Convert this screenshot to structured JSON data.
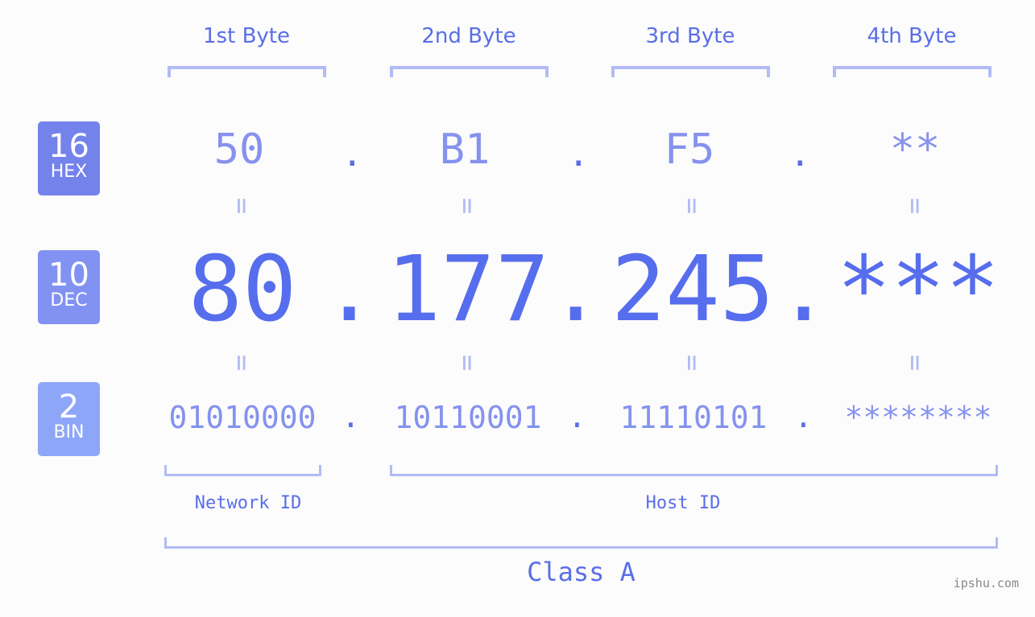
{
  "byte_headers": [
    "1st Byte",
    "2nd Byte",
    "3rd Byte",
    "4th Byte"
  ],
  "badges": {
    "hex": {
      "base": "16",
      "label": "HEX",
      "color": "#7482ec"
    },
    "dec": {
      "base": "10",
      "label": "DEC",
      "color": "#8292f2"
    },
    "bin": {
      "base": "2",
      "label": "BIN",
      "color": "#8ea6f8"
    }
  },
  "hex": [
    "50",
    "B1",
    "F5",
    "**"
  ],
  "dec": [
    "80",
    "177",
    "245",
    "***"
  ],
  "bin": [
    "01010000",
    "10110001",
    "11110101",
    "********"
  ],
  "separator": ".",
  "equals": "=",
  "network_id_label": "Network ID",
  "host_id_label": "Host ID",
  "class_label": "Class A",
  "watermark": "ipshu.com",
  "colors": {
    "primary_text": "#5a6ee8",
    "secondary_text": "#8592ee",
    "bracket": "#b2bbf6",
    "background": "#fbfcfb"
  }
}
